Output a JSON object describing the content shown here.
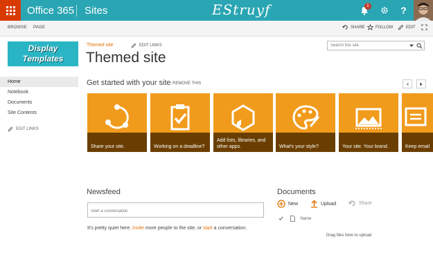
{
  "suite_bar": {
    "app_name": "Office 365",
    "section": "Sites",
    "logo_text": "EStruyf",
    "notification_count": "1",
    "help_label": "?",
    "colors": {
      "bar": "#2aa5b3",
      "waffle": "#d83b01"
    }
  },
  "ribbon": {
    "tabs": [
      "BROWSE",
      "PAGE"
    ],
    "actions": {
      "share": "SHARE",
      "follow": "FOLLOW",
      "edit": "EDIT"
    }
  },
  "site_logo": {
    "line1": "Display",
    "line2": "Templates"
  },
  "quick_launch": {
    "items": [
      "Home",
      "Notebook",
      "Documents",
      "Site Contents"
    ],
    "edit_links": "EDIT LINKS"
  },
  "title_area": {
    "breadcrumb": "Themed site",
    "edit_links": "EDIT LINKS",
    "title": "Themed site",
    "search_placeholder": "Search this site"
  },
  "get_started": {
    "heading": "Get started with your site",
    "remove": "REMOVE THIS",
    "tiles": [
      {
        "caption": "Share your site.",
        "icon": "share-icon"
      },
      {
        "caption": "Working on a deadline?",
        "icon": "clipboard-check-icon"
      },
      {
        "caption": "Add lists, libraries, and other apps.",
        "icon": "hexagon-apps-icon"
      },
      {
        "caption": "What's your style?",
        "icon": "palette-icon"
      },
      {
        "caption": "Your site. Your brand.",
        "icon": "image-brand-icon"
      },
      {
        "caption": "Keep email",
        "icon": "mail-icon"
      }
    ],
    "colors": {
      "tile": "#f19b1c",
      "band": "#6a3e00"
    }
  },
  "newsfeed": {
    "heading": "Newsfeed",
    "placeholder": "Start a conversation",
    "quiet_pre": "It's pretty quiet here. ",
    "invite": "Invite",
    "quiet_mid": " more people to the site, or ",
    "start": "start",
    "quiet_post": " a conversation."
  },
  "documents": {
    "heading": "Documents",
    "new": "New",
    "upload": "Upload",
    "share": "Share",
    "column_name": "Name",
    "drag_text": "Drag files here to upload"
  }
}
